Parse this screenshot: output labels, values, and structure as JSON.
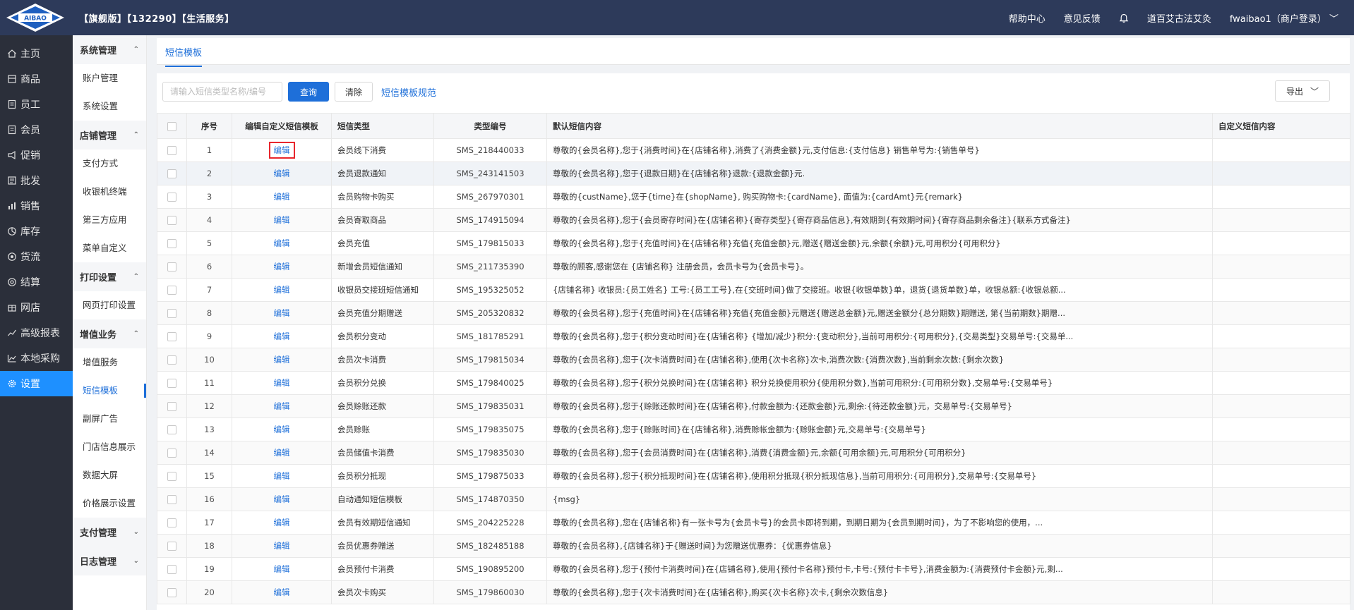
{
  "topbar": {
    "logo_text": "AIBAO",
    "title": "【旗舰版】【132290】【生活服务】",
    "help": "帮助中心",
    "feedback": "意见反馈",
    "shop_name": "道百艾古法艾灸",
    "user": "fwaibao1（商户登录）"
  },
  "sidebar": {
    "items": [
      {
        "label": "主页",
        "icon": "home-icon"
      },
      {
        "label": "商品",
        "icon": "goods-icon"
      },
      {
        "label": "员工",
        "icon": "staff-icon"
      },
      {
        "label": "会员",
        "icon": "member-icon"
      },
      {
        "label": "促销",
        "icon": "promotion-icon"
      },
      {
        "label": "批发",
        "icon": "wholesale-icon"
      },
      {
        "label": "销售",
        "icon": "sales-icon"
      },
      {
        "label": "库存",
        "icon": "inventory-icon"
      },
      {
        "label": "货流",
        "icon": "logistics-icon"
      },
      {
        "label": "结算",
        "icon": "settlement-icon"
      },
      {
        "label": "网店",
        "icon": "online-shop-icon"
      },
      {
        "label": "高级报表",
        "icon": "report-icon"
      },
      {
        "label": "本地采购",
        "icon": "purchase-icon"
      },
      {
        "label": "设置",
        "icon": "settings-icon"
      }
    ]
  },
  "subbar": {
    "g1": "系统管理",
    "g1a": "账户管理",
    "g1b": "系统设置",
    "g2": "店铺管理",
    "g2a": "支付方式",
    "g2b": "收银机终端",
    "g2c": "第三方应用",
    "g2d": "菜单自定义",
    "g3": "打印设置",
    "g3a": "网页打印设置",
    "g4": "增值业务",
    "g4a": "增值服务",
    "g4b": "短信模板",
    "g4c": "副屏广告",
    "g4d": "门店信息展示",
    "g4e": "数据大屏",
    "g4f": "价格展示设置",
    "g5": "支付管理",
    "g6": "日志管理"
  },
  "tab": {
    "label": "短信模板"
  },
  "toolbar": {
    "search_placeholder": "请输入短信类型名称/编号",
    "query": "查询",
    "clear": "清除",
    "spec_link": "短信模板规范",
    "export": "导出"
  },
  "table": {
    "headers": {
      "no": "序号",
      "edit": "编辑自定义短信模板",
      "type": "短信类型",
      "code": "类型编号",
      "default": "默认短信内容",
      "custom": "自定义短信内容"
    },
    "edit_label": "编辑",
    "rows": [
      {
        "no": "1",
        "type": "会员线下消费",
        "code": "SMS_218440033",
        "content": "尊敬的{会员名称},您于{消费时间}在{店铺名称},消费了{消费金额}元,支付信息:{支付信息} 销售单号为:{销售单号}",
        "custom": ""
      },
      {
        "no": "2",
        "type": "会员退款通知",
        "code": "SMS_243141503",
        "content": "尊敬的{会员名称},您于{退款日期}在{店铺名称}退款:{退款金额}元.",
        "custom": ""
      },
      {
        "no": "3",
        "type": "会员购物卡购买",
        "code": "SMS_267970301",
        "content": "尊敬的{custName},您于{time}在{shopName}, 购买购物卡:{cardName}, 面值为:{cardAmt}元{remark}",
        "custom": ""
      },
      {
        "no": "4",
        "type": "会员寄取商品",
        "code": "SMS_174915094",
        "content": "尊敬的{会员名称},您于{会员寄存时间}在{店铺名称}{寄存类型}{寄存商品信息},有效期到{有效期时间}{寄存商品剩余备注}{联系方式备注}",
        "custom": ""
      },
      {
        "no": "5",
        "type": "会员充值",
        "code": "SMS_179815033",
        "content": "尊敬的{会员名称},您于{充值时间}在{店铺名称}充值{充值金额}元,赠送{赠送金额}元,余额{余额}元,可用积分{可用积分}",
        "custom": ""
      },
      {
        "no": "6",
        "type": "新增会员短信通知",
        "code": "SMS_211735390",
        "content": "尊敬的顾客,感谢您在 {店铺名称} 注册会员，会员卡号为{会员卡号}。",
        "custom": ""
      },
      {
        "no": "7",
        "type": "收银员交接班短信通知",
        "code": "SMS_195325052",
        "content": "{店铺名称} 收银员:{员工姓名} 工号:{员工工号},在{交班时间}做了交接班。收银{收银单数}单，退货{退货单数}单，收银总额:{收银总额...",
        "custom": ""
      },
      {
        "no": "8",
        "type": "会员充值分期赠送",
        "code": "SMS_205320832",
        "content": "尊敬的{会员名称},您于{充值时间}在{店铺名称}充值{充值金额}元赠送{赠送总金额}元,赠送金额分{总分期数}期赠送, 第{当前期数}期赠...",
        "custom": ""
      },
      {
        "no": "9",
        "type": "会员积分变动",
        "code": "SMS_181785291",
        "content": "尊敬的{会员名称},您于{积分变动时间}在{店铺名称} {增加/减少}积分:{变动积分},当前可用积分:{可用积分},{交易类型}交易单号:{交易单...",
        "custom": ""
      },
      {
        "no": "10",
        "type": "会员次卡消费",
        "code": "SMS_179815034",
        "content": "尊敬的{会员名称},您于{次卡消费时间}在{店铺名称},使用{次卡名称}次卡,消费次数:{消费次数},当前剩余次数:{剩余次数}",
        "custom": ""
      },
      {
        "no": "11",
        "type": "会员积分兑换",
        "code": "SMS_179840025",
        "content": "尊敬的{会员名称},您于{积分兑换时间}在{店铺名称} 积分兑换使用积分{使用积分数},当前可用积分:{可用积分数},交易单号:{交易单号}",
        "custom": ""
      },
      {
        "no": "12",
        "type": "会员赊账还款",
        "code": "SMS_179835031",
        "content": "尊敬的{会员名称},您于{赊账还款时间}在{店铺名称},付款金额为:{还款金额}元,剩余:{待还款金额}元，交易单号:{交易单号}",
        "custom": ""
      },
      {
        "no": "13",
        "type": "会员赊账",
        "code": "SMS_179835075",
        "content": "尊敬的{会员名称},您于{赊账时间}在{店铺名称},消费赊帐金额为:{赊账金额}元,交易单号:{交易单号}",
        "custom": ""
      },
      {
        "no": "14",
        "type": "会员储值卡消费",
        "code": "SMS_179835030",
        "content": "尊敬的{会员名称},您于{会员消费时间}在{店铺名称},消费{消费金额}元,余额{可用余额}元,可用积分{可用积分}",
        "custom": ""
      },
      {
        "no": "15",
        "type": "会员积分抵现",
        "code": "SMS_179875033",
        "content": "尊敬的{会员名称},您于{积分抵现时间}在{店铺名称},使用积分抵现{积分抵现信息},当前可用积分:{可用积分},交易单号:{交易单号}",
        "custom": ""
      },
      {
        "no": "16",
        "type": "自动通知短信模板",
        "code": "SMS_174870350",
        "content": "{msg}",
        "custom": ""
      },
      {
        "no": "17",
        "type": "会员有效期短信通知",
        "code": "SMS_204225228",
        "content": "尊敬的{会员名称},您在{店铺名称}有一张卡号为{会员卡号}的会员卡即将到期，到期日期为{会员到期时间}，为了不影响您的使用，...",
        "custom": ""
      },
      {
        "no": "18",
        "type": "会员优惠券赠送",
        "code": "SMS_182485188",
        "content": "尊敬的{会员名称},{店铺名称}于{赠送时间}为您赠送优惠券：{优惠券信息}",
        "custom": ""
      },
      {
        "no": "19",
        "type": "会员预付卡消费",
        "code": "SMS_190895200",
        "content": "尊敬的{会员名称},您于{预付卡消费时间}在{店铺名称},使用{预付卡名称}预付卡,卡号:{预付卡卡号},消费金额为:{消费预付卡金额}元,剩...",
        "custom": ""
      },
      {
        "no": "20",
        "type": "会员次卡购买",
        "code": "SMS_179860030",
        "content": "尊敬的{会员名称},您于{次卡消费时间}在{店铺名称},购买{次卡名称}次卡,{剩余次数信息}",
        "custom": ""
      }
    ]
  },
  "colors": {
    "accent": "#1e6fd9",
    "topbar": "#2d3a5a",
    "sidebar": "#2b2f3a",
    "active_nav": "#1e90ff",
    "highlight_box": "#e8262d"
  }
}
